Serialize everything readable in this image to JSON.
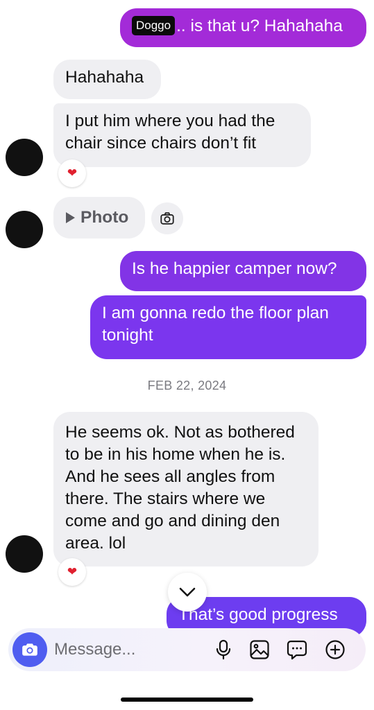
{
  "colors": {
    "accent_magenta": "#a52ad6",
    "accent_violet": "#6b3df2",
    "incoming_bubble": "#efeff2",
    "composer_camera": "#4f5df0"
  },
  "messages": {
    "m1": {
      "tag": "Doggo",
      "text": ".. is that u? Hahahaha"
    },
    "m2": {
      "text": "Hahahaha"
    },
    "m3": {
      "text": "I put him where you had the chair since chairs don’t fit",
      "reaction": "❤"
    },
    "m4": {
      "label": "Photo",
      "play_icon": "play-icon",
      "camera_icon": "camera-icon"
    },
    "m5": {
      "text": "Is he happier camper now?"
    },
    "m6": {
      "text": "I am gonna redo the floor plan tonight"
    },
    "date_separator": "FEB 22, 2024",
    "m7": {
      "text": "He seems ok. Not as bothered to be in his home when he is. And he sees all angles from there. The stairs where we come and go and dining den area. lol",
      "reaction": "❤"
    },
    "m8": {
      "text": "That’s good progress"
    }
  },
  "composer": {
    "placeholder": "Message...",
    "icons": [
      "camera-icon",
      "microphone-icon",
      "gallery-icon",
      "sticker-icon",
      "plus-icon"
    ]
  },
  "scroll_button_icon": "chevron-down-icon"
}
